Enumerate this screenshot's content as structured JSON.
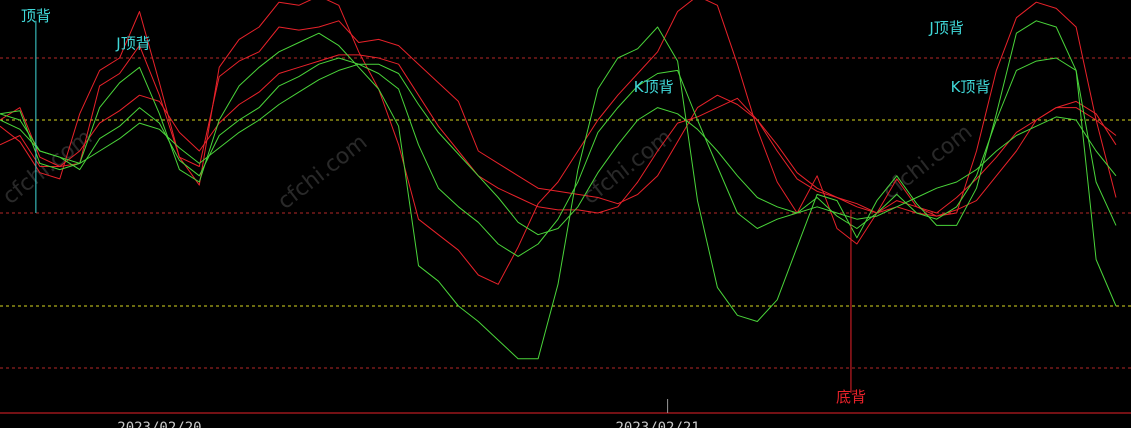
{
  "chart_data": {
    "type": "line",
    "title": "",
    "xlabel": "",
    "ylabel": "",
    "x": [
      0,
      1,
      2,
      3,
      4,
      5,
      6,
      7,
      8,
      9,
      10,
      11,
      12,
      13,
      14,
      15,
      16,
      17,
      18,
      19,
      20,
      21,
      22,
      23,
      24,
      25,
      26,
      27,
      28,
      29,
      30,
      31,
      32,
      33,
      34,
      35,
      36,
      37,
      38,
      39,
      40,
      41,
      42,
      43,
      44,
      45,
      46,
      47,
      48,
      49,
      50,
      51,
      52,
      53,
      54,
      55,
      56
    ],
    "xlim": [
      0,
      56
    ],
    "ylim": [
      -20,
      120
    ],
    "x_tick_labels": [
      {
        "x": 8,
        "label": "2023/02/20"
      },
      {
        "x": 33,
        "label": "2023/02/21"
      }
    ],
    "ref_lines": [
      {
        "y": 100,
        "color": "#b32828",
        "style": "dashed"
      },
      {
        "y": 80,
        "color": "#d8d820",
        "style": "dashed"
      },
      {
        "y": 50,
        "color": "#b32828",
        "style": "dashed"
      },
      {
        "y": 20,
        "color": "#d8d820",
        "style": "dashed"
      },
      {
        "y": 0,
        "color": "#b32828",
        "style": "dashed"
      }
    ],
    "series": [
      {
        "name": "",
        "color": "#e8222a",
        "width": 1,
        "values": [
          80,
          84,
          68,
          65,
          66,
          91,
          95,
          104,
          88,
          68,
          65,
          94,
          99,
          102,
          110,
          109,
          110,
          112,
          105,
          106,
          104,
          98,
          92,
          86,
          70,
          66,
          62,
          58,
          57,
          56,
          55,
          53,
          56,
          62,
          73,
          84,
          88,
          85,
          80,
          70,
          61,
          57,
          55,
          53,
          50,
          54,
          52,
          50,
          55,
          61,
          68,
          76,
          80,
          84,
          84,
          80,
          75
        ]
      },
      {
        "name": "",
        "color": "#e8222a",
        "width": 1,
        "values": [
          72,
          75,
          65,
          65,
          70,
          79,
          83,
          88,
          86,
          76,
          70,
          79,
          85,
          89,
          95,
          97,
          99,
          101,
          101,
          100,
          98,
          88,
          78,
          70,
          62,
          58,
          55,
          52,
          51,
          51,
          50,
          52,
          60,
          70,
          79,
          81,
          84,
          87,
          80,
          72,
          63,
          58,
          55,
          52,
          50,
          52,
          50,
          49,
          51,
          54,
          62,
          70,
          80,
          84,
          86,
          82,
          72
        ]
      },
      {
        "name": "",
        "color": "#e8222a",
        "width": 1,
        "values": [
          78,
          73,
          63,
          61,
          82,
          96,
          100,
          115,
          92,
          68,
          59,
          97,
          106,
          110,
          118,
          117,
          120,
          117,
          102,
          90,
          72,
          48,
          43,
          38,
          30,
          27,
          39,
          53,
          60,
          70,
          80,
          88,
          95,
          102,
          115,
          120,
          117,
          98,
          77,
          60,
          50,
          62,
          45,
          40,
          50,
          61,
          52,
          49,
          50,
          70,
          96,
          113,
          118,
          116,
          110,
          80,
          55
        ]
      },
      {
        "name": "",
        "color": "#4ad43a",
        "width": 1,
        "values": [
          82,
          80,
          70,
          68,
          66,
          70,
          74,
          79,
          77,
          71,
          66,
          71,
          76,
          80,
          85,
          89,
          93,
          96,
          98,
          98,
          95,
          85,
          76,
          69,
          62,
          55,
          47,
          43,
          45,
          52,
          63,
          72,
          80,
          84,
          82,
          77,
          70,
          62,
          55,
          52,
          50,
          52,
          50,
          48,
          49,
          52,
          55,
          58,
          60,
          64,
          70,
          75,
          78,
          81,
          80,
          70,
          62
        ]
      },
      {
        "name": "",
        "color": "#4ad43a",
        "width": 1,
        "values": [
          80,
          77,
          70,
          68,
          64,
          74,
          78,
          84,
          79,
          67,
          62,
          75,
          80,
          84,
          91,
          94,
          98,
          100,
          98,
          95,
          90,
          72,
          58,
          52,
          47,
          40,
          36,
          40,
          48,
          60,
          76,
          84,
          91,
          95,
          96,
          80,
          65,
          50,
          45,
          48,
          50,
          55,
          49,
          45,
          50,
          56,
          50,
          48,
          52,
          62,
          80,
          96,
          99,
          100,
          96,
          60,
          46
        ]
      },
      {
        "name": "",
        "color": "#4ad43a",
        "width": 1,
        "values": [
          82,
          83,
          66,
          64,
          66,
          84,
          92,
          97,
          82,
          64,
          60,
          80,
          91,
          97,
          102,
          105,
          108,
          104,
          97,
          90,
          78,
          33,
          28,
          20,
          15,
          9,
          3,
          3,
          27,
          64,
          90,
          100,
          103,
          110,
          99,
          54,
          26,
          17,
          15,
          22,
          39,
          56,
          54,
          42,
          54,
          62,
          53,
          46,
          46,
          58,
          82,
          108,
          112,
          110,
          96,
          35,
          20
        ]
      }
    ],
    "annotations": [
      {
        "text": "顶背",
        "color": "#40d8d8",
        "x": 1.8,
        "y": 112
      },
      {
        "text": "J顶背",
        "color": "#40d8d8",
        "x": 6.7,
        "y": 103
      },
      {
        "text": "K顶背",
        "color": "#40d8d8",
        "x": 32.8,
        "y": 89
      },
      {
        "text": "J顶背",
        "color": "#40d8d8",
        "x": 47.5,
        "y": 108
      },
      {
        "text": "K顶背",
        "color": "#40d8d8",
        "x": 48.7,
        "y": 89
      },
      {
        "text": "底背",
        "color": "#e8222a",
        "x": 42.7,
        "y": -11
      }
    ],
    "markers": [
      {
        "x": 1.8,
        "from": 112,
        "to": 50,
        "color": "#40d8d8"
      },
      {
        "x": 42.7,
        "from": 51,
        "to": -8,
        "color": "#e8222a"
      }
    ],
    "grid": false,
    "legend": "none",
    "bg_color": "#000000",
    "axis_color": "#e8222a"
  },
  "watermark": "cfchi.com"
}
